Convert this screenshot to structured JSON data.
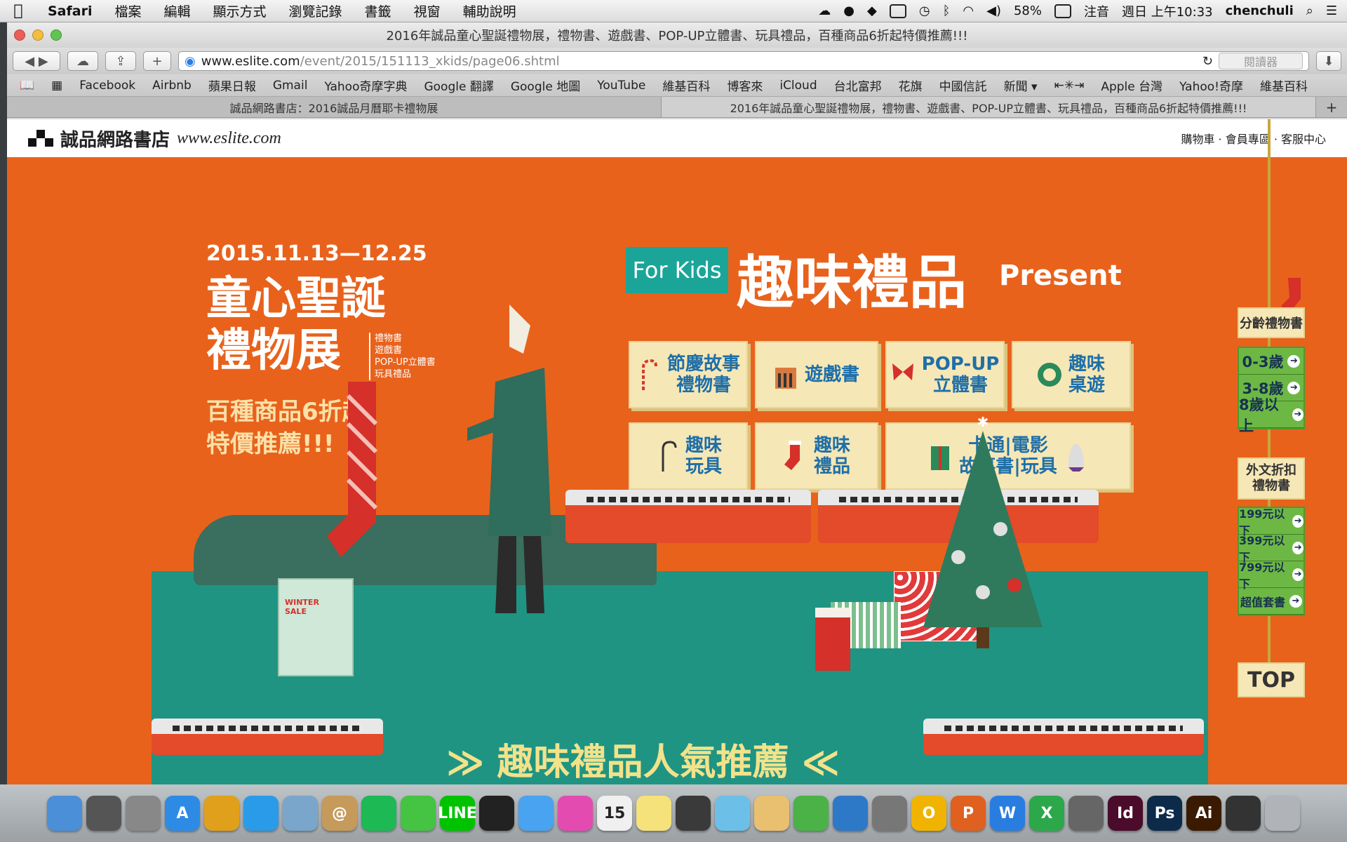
{
  "menubar": {
    "app": "Safari",
    "items": [
      "檔案",
      "編輯",
      "顯示方式",
      "瀏覽記錄",
      "書籤",
      "視窗",
      "輔助說明"
    ],
    "battery": "58%",
    "input": "注音",
    "clock": "週日 上午10:33",
    "user": "chenchuli"
  },
  "window": {
    "title": "2016年誠品童心聖誕禮物展，禮物書、遊戲書、POP-UP立體書、玩具禮品，百種商品6折起特價推薦!!!"
  },
  "toolbar": {
    "url_host": "www.eslite.com",
    "url_path": "/event/2015/151113_xkids/page06.shtml",
    "reader": "閱讀器"
  },
  "bookmarks": [
    "Facebook",
    "Airbnb",
    "蘋果日報",
    "Gmail",
    "Yahoo奇摩字典",
    "Google 翻譯",
    "Google 地圖",
    "YouTube",
    "維基百科",
    "博客來",
    "iCloud",
    "台北富邦",
    "花旗",
    "中國信託",
    "新聞 ▾",
    "⇤✳⇥",
    "Apple 台灣",
    "Yahoo!奇摩",
    "維基百科"
  ],
  "tabs": [
    {
      "label": "誠品網路書店：2016誠品月曆耶卡禮物展"
    },
    {
      "label": "2016年誠品童心聖誕禮物展，禮物書、遊戲書、POP-UP立體書、玩具禮品，百種商品6折起特價推薦!!!"
    }
  ],
  "site": {
    "logo_text": "誠品網路書店",
    "logo_url": "www.eslite.com",
    "top_links": "購物車 · 會員專區 · 客服中心"
  },
  "hero": {
    "date": "2015.11.13—12.25",
    "title_line1": "童心聖誕",
    "title_line2": "禮物展",
    "subcats": [
      "禮物書",
      "遊戲書",
      "POP-UP立體書",
      "玩具禮品"
    ],
    "promo_line1": "百種商品6折起",
    "promo_line2": "特價推薦!!!",
    "for_kids": "For Kids",
    "gift_title": "趣味禮品",
    "gift_sub": "Present",
    "winter_sale": "WINTER SALE",
    "banner": "≫ 趣味禮品人氣推薦 ≪"
  },
  "categories": [
    {
      "line1": "節慶故事",
      "line2": "禮物書"
    },
    {
      "line1": "遊戲書",
      "line2": ""
    },
    {
      "line1": "POP-UP",
      "line2": "立體書"
    },
    {
      "line1": "趣味",
      "line2": "桌遊"
    },
    {
      "line1": "趣味",
      "line2": "玩具"
    },
    {
      "line1": "趣味",
      "line2": "禮品"
    },
    {
      "line1": "卡通|電影",
      "line2": "故事書|玩具"
    }
  ],
  "sidebar": {
    "age_title": "分齡禮物書",
    "ages": [
      "0-3歲",
      "3-8歲",
      "8歲以上"
    ],
    "foreign_title": "外文折扣禮物書",
    "prices": [
      "199元以下",
      "399元以下",
      "799元以下",
      "超值套書"
    ],
    "top": "TOP"
  },
  "dock": [
    {
      "label": "Finder",
      "color": "#4a8fd8",
      "glyph": ""
    },
    {
      "label": "Launchpad",
      "color": "#555",
      "glyph": ""
    },
    {
      "label": "System Preferences",
      "color": "#888",
      "glyph": ""
    },
    {
      "label": "App Store",
      "color": "#2d8be6",
      "glyph": "A"
    },
    {
      "label": "Chrome",
      "color": "#e0a01c",
      "glyph": ""
    },
    {
      "label": "Safari",
      "color": "#2a9be8",
      "glyph": ""
    },
    {
      "label": "Preview",
      "color": "#7aa6cc",
      "glyph": ""
    },
    {
      "label": "Contacts",
      "color": "#c59a5b",
      "glyph": "@"
    },
    {
      "label": "Spotify",
      "color": "#1db954",
      "glyph": ""
    },
    {
      "label": "WeChat",
      "color": "#45c342",
      "glyph": ""
    },
    {
      "label": "LINE",
      "color": "#00c300",
      "glyph": "LINE"
    },
    {
      "label": "QQ",
      "color": "#222",
      "glyph": ""
    },
    {
      "label": "Messages",
      "color": "#4aa3f0",
      "glyph": ""
    },
    {
      "label": "iTunes",
      "color": "#e44bb0",
      "glyph": ""
    },
    {
      "label": "Calendar",
      "color": "#f0f0f0",
      "glyph": "15"
    },
    {
      "label": "Notes",
      "color": "#f5e27a",
      "glyph": ""
    },
    {
      "label": "FaceTime",
      "color": "#3a3a3a",
      "glyph": ""
    },
    {
      "label": "Photos",
      "color": "#6cc0e8",
      "glyph": ""
    },
    {
      "label": "TextEdit",
      "color": "#e8c070",
      "glyph": ""
    },
    {
      "label": "Numbers",
      "color": "#4bb248",
      "glyph": ""
    },
    {
      "label": "Keynote",
      "color": "#2e78c8",
      "glyph": ""
    },
    {
      "label": "Tools",
      "color": "#777",
      "glyph": ""
    },
    {
      "label": "Office O",
      "color": "#f0b400",
      "glyph": "O"
    },
    {
      "label": "Office P",
      "color": "#e06020",
      "glyph": "P"
    },
    {
      "label": "Office W",
      "color": "#2a7de0",
      "glyph": "W"
    },
    {
      "label": "Office X",
      "color": "#2ca84a",
      "glyph": "X"
    },
    {
      "label": "Image Capture",
      "color": "#666",
      "glyph": ""
    },
    {
      "label": "InDesign",
      "color": "#4a0c2a",
      "glyph": "Id"
    },
    {
      "label": "Photoshop",
      "color": "#0c2a4a",
      "glyph": "Ps"
    },
    {
      "label": "Illustrator",
      "color": "#3a1a00",
      "glyph": "Ai"
    },
    {
      "label": "Printer",
      "color": "#333",
      "glyph": ""
    },
    {
      "label": "Trash",
      "color": "#b0b4b8",
      "glyph": ""
    }
  ],
  "colors": {
    "page_bg": "#e8621c",
    "teal": "#1f9483",
    "cream": "#f6e7b6",
    "blue_text": "#1f6fa8",
    "green_side": "#6db845"
  }
}
